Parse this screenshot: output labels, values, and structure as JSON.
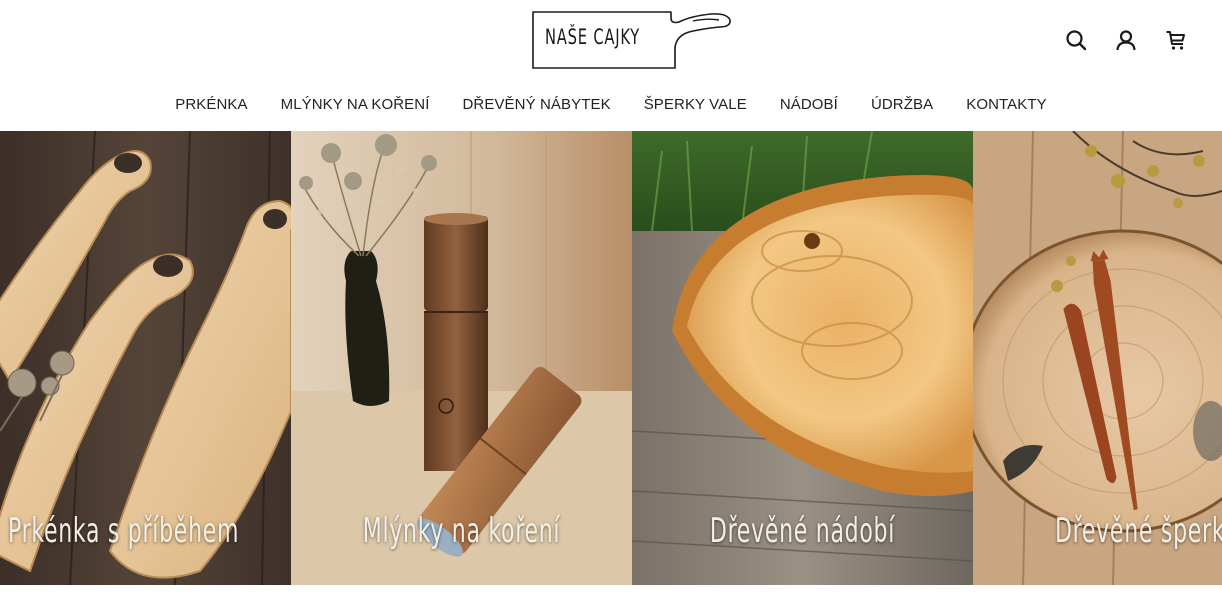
{
  "header": {
    "logo_text": "NAŠE CAJKY",
    "icons": [
      "search-icon",
      "user-icon",
      "cart-icon"
    ]
  },
  "nav": {
    "items": [
      {
        "label": "PRKÉNKA"
      },
      {
        "label": "MLÝNKY NA KOŘENÍ"
      },
      {
        "label": "DŘEVĚNÝ NÁBYTEK"
      },
      {
        "label": "ŠPERKY VALE"
      },
      {
        "label": "NÁDOBÍ"
      },
      {
        "label": "ÚDRŽBA"
      },
      {
        "label": "KONTAKTY"
      }
    ]
  },
  "tiles": [
    {
      "label": "Prkénka s příběhem"
    },
    {
      "label": "Mlýnky na koření"
    },
    {
      "label": "Dřevěné nádobí"
    },
    {
      "label": "Dřevěné šperky"
    }
  ],
  "colors": {
    "text": "#1a1a1a",
    "tile_label": "#f4efe6",
    "wood_dark": "#4a3a30",
    "wood_light": "#e9c48f",
    "wood_orange": "#e0a24a"
  }
}
